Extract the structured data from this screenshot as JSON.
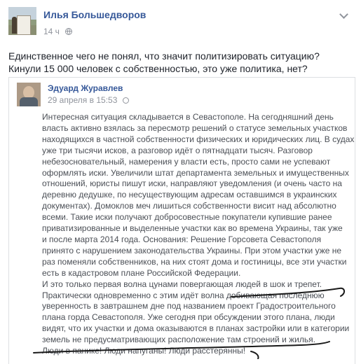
{
  "post": {
    "author": "Илья Большедворов",
    "timestamp": "14 ч",
    "text_lines": [
      "Единственное чего не понял, что значит политизировать ситуацию?",
      "Кинули 15 000 человек с собственностью, это уже политика, нет?"
    ]
  },
  "shared": {
    "author": "Эдуард Журавлев",
    "timestamp": "29 апреля в 15:53",
    "body_lines": [
      "Интересная ситуация складывается в Севастополе. На сегодняшний день",
      "власть активно взялась за пересмотр решений о статусе земельных участков",
      "находящихся в частной собственности физических и юридических лиц. В судах",
      "уже три тысячи исков, а разговор идёт о пятнадцати тысяч. Разговор",
      "небезосновательный, намерения у власти есть, просто сами не успевают",
      "оформлять иски. Увеличили штат департамента земельных и имущественных",
      "отношений, юристы пишут иски, направляют уведомления (и очень часто на",
      "деревню дедушке, по несуществующим адресам оставшимся в украинских",
      "документах). Домоклов меч лишиться собственности висит над абсолютно",
      "всеми. Такие иски получают добросовестные покупатели купившие ранее",
      "приватизированные и выделенные участки как во времена Украины, так уже",
      "и после марта 2014 года. Основания: Решение Горсовета Севастополя",
      "принято с нарушением законодательства Украины. При этом участки уже не",
      "раз поменяли собственников, на них стоят дома и гостиницы, все эти участки",
      "есть в кадастровом плане Российской Федерации.",
      "И это только первая волна цунами повергающая людей в шок и трепет.",
      "Практически одновременно с этим идёт волна добивающая последнюю",
      "уверенность в завтрашнем дне под названием проект Градостроительного",
      "плана горда Севастополя. Уже сегодня при обсуждении этого плана, люди",
      "видят, что их участки и дома оказываются в планах застройки или в категории",
      "земель не предусматривающих расположение там строений и жилья.",
      "Люди в панике! Люди напуганы! Люди расстерянны!"
    ]
  },
  "icons": {
    "options": "chevron-down-icon",
    "audience": "globe-icon"
  },
  "colors": {
    "link": "#365899",
    "meta": "#90949c",
    "text": "#1d2129",
    "annotation": "#1a1a1a"
  }
}
